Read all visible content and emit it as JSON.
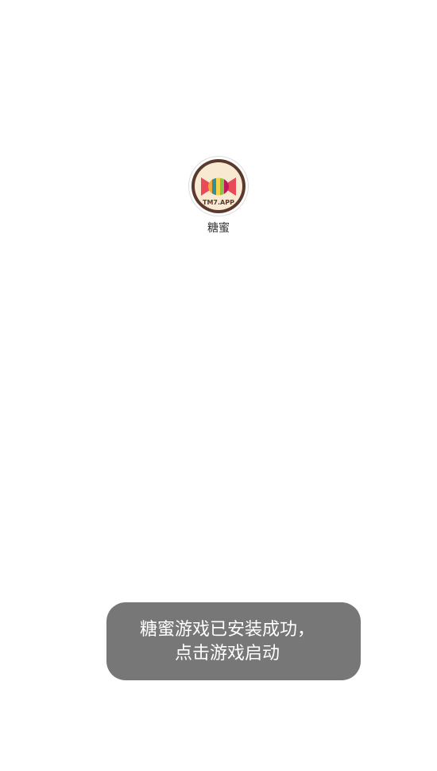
{
  "app": {
    "name": "糖蜜",
    "icon": "candy-icon",
    "icon_text": "TM7.APP"
  },
  "toast": {
    "line1": "糖蜜游戏已安装成功，",
    "line2": "点击游戏启动"
  },
  "colors": {
    "background": "#ffffff",
    "toast_bg": "#777777",
    "toast_text": "#ffffff",
    "icon_ring": "#5a3a2e",
    "icon_face": "#f8e9d2"
  }
}
